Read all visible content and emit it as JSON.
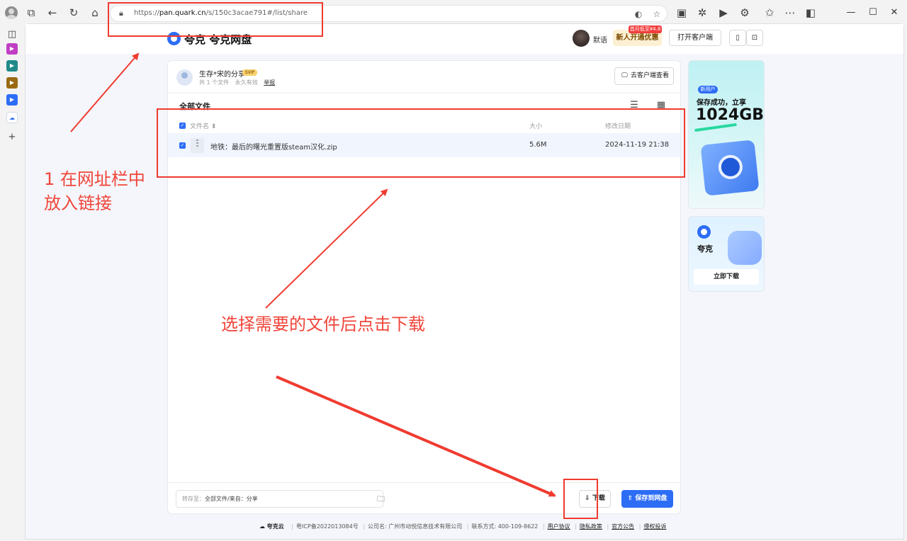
{
  "browser": {
    "url_prefix": "https://",
    "url_host": "pan.quark.cn",
    "url_path": "/s/150c3acae791#/list/share"
  },
  "header": {
    "logo_text": "夸克  夸克网盘",
    "user_name": "默语",
    "promo_badge": "首月低至¥4.8",
    "promo_button": "新人开通优惠",
    "open_client_button": "打开客户端"
  },
  "share": {
    "title": "生存*宋的分享",
    "badge": "SVIP",
    "file_count": "共 1 个文件",
    "validity": "永久有效",
    "report": "举报",
    "view_in_client": "去客户端查看"
  },
  "list": {
    "section_title": "全部文件",
    "columns": {
      "name": "文件名 ⬍",
      "size": "大小",
      "modified": "修改日期"
    },
    "rows": [
      {
        "name": "地铁：最后的曙光重置版steam汉化.zip",
        "size": "5.6M",
        "modified": "2024-11-19 21:38"
      }
    ]
  },
  "bottom": {
    "save_to_label": "转存至：",
    "save_to_path": "全部文件/来自：分享",
    "download_button": "下载",
    "save_button": "保存到网盘"
  },
  "ads": {
    "ad1_tag": "新用户",
    "ad1_line1": "保存成功，立享",
    "ad1_big": "1024GB",
    "ad2_name": "夸克",
    "ad2_button": "立即下载"
  },
  "footer": {
    "brand": "夸克云",
    "icp": "粤ICP备2022013084号",
    "company": "公司名: 广州市动悦信息技术有限公司",
    "contact": "联系方式: 400-109-8622",
    "links": [
      "用户协议",
      "隐私政策",
      "官方公告",
      "侵权投诉"
    ]
  },
  "annotations": {
    "step1_line1": "1 在网址栏中",
    "step1_line2": "放入链接",
    "step2": "选择需要的文件后点击下载",
    "color": "#f03b30"
  },
  "colors": {
    "accent": "#2d6df6",
    "annotation": "#f03b30"
  }
}
